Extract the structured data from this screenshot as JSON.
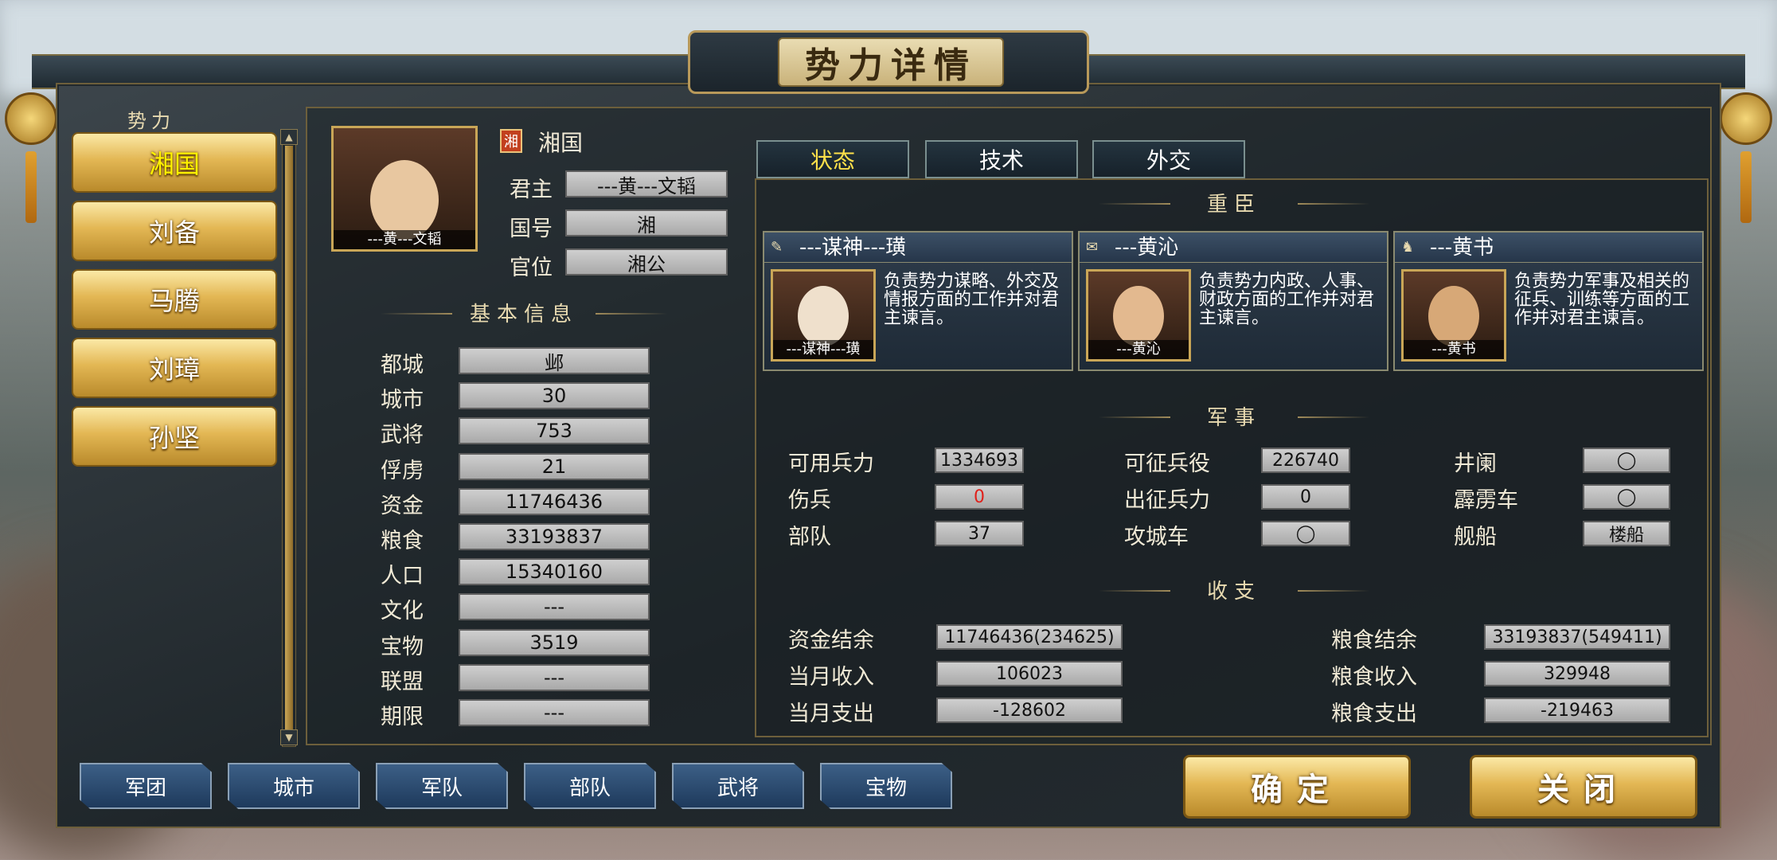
{
  "window": {
    "title": "势力详情"
  },
  "sidebar": {
    "label": "势力",
    "items": [
      {
        "label": "湘国",
        "active": true
      },
      {
        "label": "刘备"
      },
      {
        "label": "马腾"
      },
      {
        "label": "刘璋"
      },
      {
        "label": "孙坚"
      }
    ],
    "scroll_up": "▲",
    "scroll_down": "▼"
  },
  "ruler": {
    "portrait_caption": "---黄---文韬",
    "flag_char": "湘",
    "faction_name": "湘国",
    "fields": [
      {
        "label": "君主",
        "value": "---黄---文韬"
      },
      {
        "label": "国号",
        "value": "湘"
      },
      {
        "label": "官位",
        "value": "湘公"
      }
    ]
  },
  "basic_info": {
    "title": "基本信息",
    "rows": [
      {
        "label": "都城",
        "value": "邺"
      },
      {
        "label": "城市",
        "value": "30"
      },
      {
        "label": "武将",
        "value": "753"
      },
      {
        "label": "俘虏",
        "value": "21"
      },
      {
        "label": "资金",
        "value": "11746436"
      },
      {
        "label": "粮食",
        "value": "33193837"
      },
      {
        "label": "人口",
        "value": "15340160"
      },
      {
        "label": "文化",
        "value": "---"
      },
      {
        "label": "宝物",
        "value": "3519"
      },
      {
        "label": "联盟",
        "value": "---"
      },
      {
        "label": "期限",
        "value": "---"
      }
    ]
  },
  "tabs": [
    {
      "label": "状态",
      "active": true
    },
    {
      "label": "技术"
    },
    {
      "label": "外交"
    }
  ],
  "ministers": {
    "title": "重臣",
    "cards": [
      {
        "icon": "advisor-icon",
        "icon_glyph": "✎",
        "name": "---谋神---璜",
        "caption": "---谋神---璜",
        "desc": "负责势力谋略、外交及情报方面的工作并对君主谏言。"
      },
      {
        "icon": "admin-icon",
        "icon_glyph": "✉",
        "name": "---黄沁",
        "caption": "---黄沁",
        "desc": "负责势力内政、人事、财政方面的工作并对君主谏言。"
      },
      {
        "icon": "military-icon",
        "icon_glyph": "♞",
        "name": "---黄书",
        "caption": "---黄书",
        "desc": "负责势力军事及相关的征兵、训练等方面的工作并对君主谏言。"
      }
    ]
  },
  "military": {
    "title": "军事",
    "col1": [
      {
        "label": "可用兵力",
        "value": "1334693"
      },
      {
        "label": "伤兵",
        "value": "0",
        "color": "#e0201a"
      },
      {
        "label": "部队",
        "value": "37"
      }
    ],
    "col2": [
      {
        "label": "可征兵役",
        "value": "226740"
      },
      {
        "label": "出征兵力",
        "value": "0"
      },
      {
        "label": "攻城车",
        "value": "◯"
      }
    ],
    "col3": [
      {
        "label": "井阑",
        "value": "◯"
      },
      {
        "label": "霹雳车",
        "value": "◯"
      },
      {
        "label": "舰船",
        "value": "楼船"
      }
    ]
  },
  "finance": {
    "title": "收支",
    "left": [
      {
        "label": "资金结余",
        "value": "11746436(234625)"
      },
      {
        "label": "当月收入",
        "value": "106023"
      },
      {
        "label": "当月支出",
        "value": "-128602"
      }
    ],
    "right": [
      {
        "label": "粮食结余",
        "value": "33193837(549411)"
      },
      {
        "label": "粮食收入",
        "value": "329948"
      },
      {
        "label": "粮食支出",
        "value": "-219463"
      }
    ]
  },
  "bottom_tabs": [
    "军团",
    "城市",
    "军队",
    "部队",
    "武将",
    "宝物"
  ],
  "actions": {
    "confirm": "确定",
    "close": "关闭"
  },
  "colors": {
    "gold": "#e3b754",
    "active_text": "#fff200",
    "tab_active": "#ffe14a",
    "negative": "#e0201a"
  }
}
